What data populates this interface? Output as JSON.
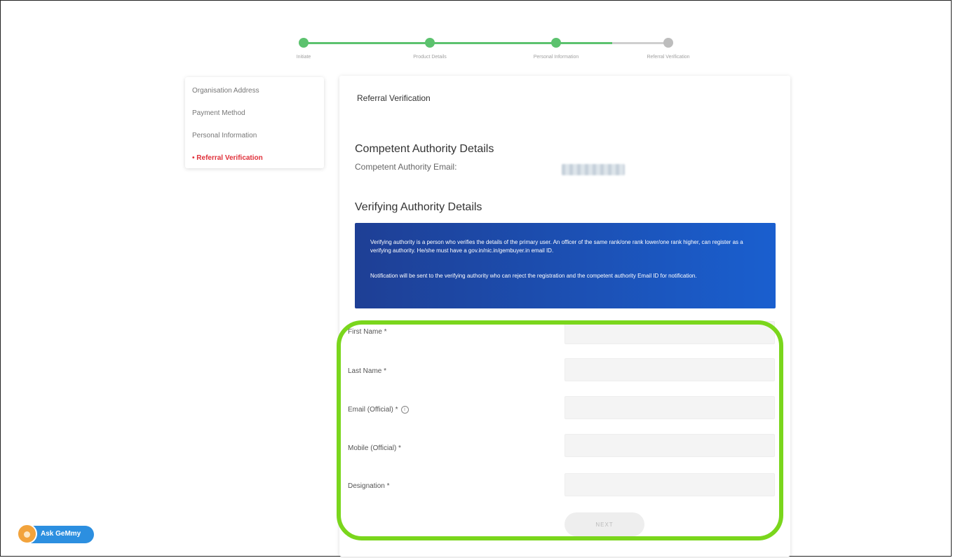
{
  "stepper": {
    "steps": [
      {
        "label": "Initiate",
        "state": "done"
      },
      {
        "label": "Product Details",
        "state": "done"
      },
      {
        "label": "Personal Information",
        "state": "done"
      },
      {
        "label": "Referral Verification",
        "state": "todo"
      }
    ],
    "colors": {
      "done": "#5cc26e",
      "todo": "#bdbdbd"
    }
  },
  "sidebar": {
    "items": [
      {
        "label": "Organisation Address",
        "active": false
      },
      {
        "label": "Payment Method",
        "active": false
      },
      {
        "label": "Personal Information",
        "active": false
      },
      {
        "label": "• Referral Verification",
        "active": true
      }
    ],
    "active_color": "#e0303a"
  },
  "card": {
    "title": "Referral Verification",
    "competent": {
      "heading": "Competent Authority Details",
      "email_label": "Competent Authority Email:"
    },
    "verifying": {
      "heading": "Verifying Authority Details",
      "info_p1": "Verifying authority is a person who verifies the details of the primary user. An officer of the same rank/one rank lower/one rank higher, can register as a verifying authority. He/she must have a gov.in/nic.in/gembuyer.in email ID.",
      "info_p2": "Notification will be sent to the verifying authority who can reject the registration and the competent authority Email ID for notification."
    },
    "form": {
      "first_name_label": "First Name *",
      "last_name_label": "Last Name *",
      "email_label": "Email (Official) *",
      "mobile_label": "Mobile (Official) *",
      "designation_label": "Designation *",
      "first_name_value": "",
      "last_name_value": "",
      "email_value": "",
      "mobile_value": "",
      "designation_value": "",
      "next_label": "NEXT"
    }
  },
  "ask_button": {
    "label": "Ask GeMmy",
    "icon": "gemmy-avatar-icon"
  },
  "highlight_color": "#7ad61c"
}
